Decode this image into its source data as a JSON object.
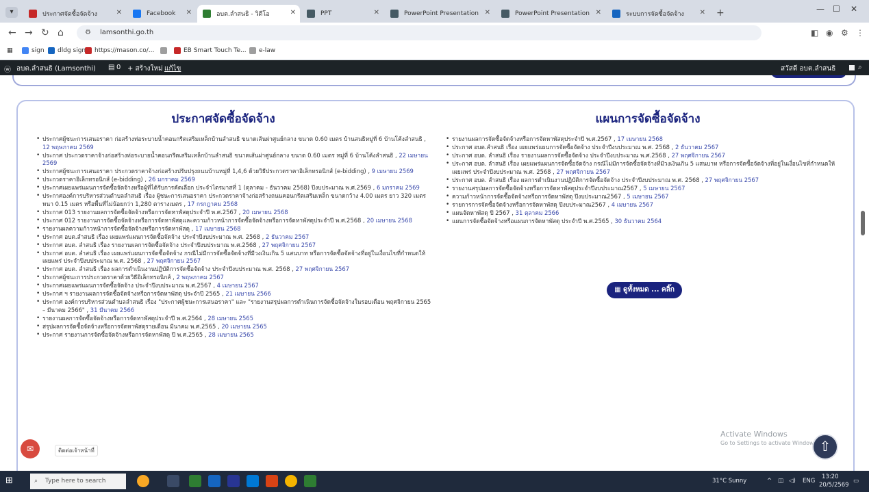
{
  "browser": {
    "tabs": [
      {
        "label": "ประกาศจัดซื้อจัดจ้าง",
        "color": "#c62828",
        "active": false
      },
      {
        "label": "Facebook",
        "color": "#1877f2",
        "active": false
      },
      {
        "label": "อบต.ลำสนธิ - วิดีโอ",
        "color": "#2e7d32",
        "active": true
      },
      {
        "label": "PPT",
        "color": "#455a64",
        "active": false
      },
      {
        "label": "PowerPoint Presentation",
        "color": "#455a64",
        "active": false
      },
      {
        "label": "PowerPoint Presentation",
        "color": "#455a64",
        "active": false
      },
      {
        "label": "ระบบการจัดซื้อจัดจ้าง",
        "color": "#1565c0",
        "active": false
      }
    ],
    "url": "lamsonthi.go.th",
    "bookmarks": [
      {
        "label": "sign",
        "color": "#4285f4"
      },
      {
        "label": "dldg sign",
        "color": "#1565c0"
      },
      {
        "label": "https://mason.co/...",
        "color": "#c62828"
      },
      {
        "label": "",
        "color": "#9e9e9e"
      },
      {
        "label": "EB Smart Touch Te...",
        "color": "#c62828"
      },
      {
        "label": "e-law",
        "color": "#9e9e9e"
      }
    ]
  },
  "adminbar": {
    "site_name": "อบต.ลำสนธิ (Lamsonthi)",
    "comments": "0",
    "new_label": "+ สร้างใหม่",
    "edit_label": "แก้ไข",
    "user_label": "สวัสดี อบต.ลำสนธิ"
  },
  "left": {
    "title": "ประกาศจัดซื้อจัดจ้าง",
    "items": [
      {
        "text": "ประกาศผู้ชนะการเสนอราคา ก่อสร้างท่อระบายน้ำคอนกรีตเสริมเหล็กบ้านลำสนธิ ขนาดเส้นผ่าศูนย์กลาง ขนาด 0.60 เมตร บ้านสนธิหมู่ที่ 6 บ้านโค้งลำสนธิ",
        "date": "12 พฤษภาคม 2569"
      },
      {
        "text": "ประกาศ ประกวดราคาจ้างก่อสร้างท่อระบายน้ำคอนกรีตเสริมเหล็กบ้านลำสนธิ ขนาดเส้นผ่าศูนย์กลาง ขนาด 0.60 เมตร หมู่ที่ 6 บ้านโค้งลำสนธิ",
        "date": "22 เมษายน 2569"
      },
      {
        "text": "ประกาศผู้ชนะการเสนอราคา ประกวดราคาจ้างก่อสร้างปรับปรุงถนนบ้านหมู่ที่ 1,4,6 ด้วยวิธีประกวดราคาอิเล็กทรอนิกส์ (e-bidding)",
        "date": "9 เมษายน 2569"
      },
      {
        "text": "ประกวดราคาอิเล็กทรอนิกส์ (e-bidding)",
        "date": "26 มกราคม 2569"
      },
      {
        "text": "ประกาศเผยแพร่แผนการจัดซื้อจัดจ้างหรือผู้ที่ได้รับการคัดเลือก ประจำไตรมาสที่ 1 (ตุลาคม - ธันวาคม 2568) ปีงบประมาณ พ.ศ.2569",
        "date": "6 มกราคม 2569"
      },
      {
        "text": "ประกาศองค์การบริหารส่วนตำบลลำสนธิ เรื่อง ผู้ชนะการเสนอราคา ประกวดราคาจ้างก่อสร้างถนนคอนกรีตเสริมเหล็ก ขนาดกว้าง 4.00 เมตร ยาว 320 เมตร หนา 0.15 เมตร หรือพื้นที่ไม่น้อยกว่า 1,280 ตารางเมตร",
        "date": "17 กรกฎาคม 2568"
      },
      {
        "text": "ประกาศ 013 รายงานผลการจัดซื้อจัดจ้างหรือการจัดหาพัสดุประจำปี พ.ศ.2567",
        "date": "20 เมษายน 2568"
      },
      {
        "text": "ประกาศ 012 รายงานการจัดซื้อจัดจ้างหรือการจัดหาพัสดุและความก้าวหน้าการจัดซื้อจัดจ้างหรือการจัดหาพัสดุประจำปี พ.ศ.2568",
        "date": "20 เมษายน 2568"
      },
      {
        "text": "รายงานผลความก้าวหน้าการจัดซื้อจัดจ้างหรือการจัดหาพัสดุ",
        "date": "17 เมษายน 2568"
      },
      {
        "text": "ประกาศ อบต.ลำสนธิ เรื่อง เผยแพร่แผนการจัดซื้อจัดจ้าง ประจำปีงบประมาณ พ.ศ. 2568",
        "date": "2 ธันวาคม 2567"
      },
      {
        "text": "ประกาศ อบต. ลำสนธิ เรื่อง รายงานผลการจัดซื้อจัดจ้าง ประจำปีงบประมาณ พ.ศ.2568",
        "date": "27 พฤศจิกายน 2567"
      },
      {
        "text": "ประกาศ อบต. ลำสนธิ เรื่อง เผยแพร่แผนการจัดซื้อจัดจ้าง กรณีไม่มีการจัดซื้อจัดจ้างที่มีวงเงินเกิน 5 แสนบาท หรือการจัดซื้อจัดจ้างที่อยู่ในเงื่อนไขที่กำหนดให้เผยแพร่ ประจำปีงบประมาณ พ.ศ. 2568",
        "date": "27 พฤศจิกายน 2567"
      },
      {
        "text": "ประกาศ อบต. ลำสนธิ เรื่อง ผลการดำเนินงานปฏิบัติการจัดซื้อจัดจ้าง ประจำปีงบประมาณ พ.ศ. 2568",
        "date": "27 พฤศจิกายน 2567"
      },
      {
        "text": "ประกาศผู้ชนะการประกวดราคาด้วยวิธีอิเล็กทรอนิกส์",
        "date": "2 พฤษภาคม 2567"
      },
      {
        "text": "ประกาศเผยแพร่แผนการจัดซื้อจัดจ้าง ประจำปีงบประมาณ พ.ศ.2567",
        "date": "4 เมษายน 2567"
      },
      {
        "text": "ประกาศ ฯ รายงานผลการจัดซื้อจัดจ้างหรือการจัดหาพัสดุ ประจำปี 2565",
        "date": "21 เมษายน 2566"
      },
      {
        "text": "ประกาศ องค์การบริหารส่วนตำบลลำสนธิ เรื่อง \"ประกาศผู้ชนะการเสนอราคา\" และ \"รายงานสรุปผลการดำเนินการจัดซื้อจัดจ้างในรอบเดือน พฤศจิกายน 2565 – มีนาคม 2566\"",
        "date": "31 มีนาคม 2566"
      },
      {
        "text": "รายงานผลการจัดซื้อจัดจ้างหรือการจัดหาพัสดุประจำปี พ.ศ.2564",
        "date": "28 เมษายน 2565"
      },
      {
        "text": "สรุปผลการจัดซื้อจัดจ้างหรือการจัดหาพัสดุรายเดือน มีนาคม พ.ศ.2565",
        "date": "20 เมษายน 2565"
      },
      {
        "text": "ประกาศ รายงานการจัดซื้อจัดจ้างหรือการจัดหาพัสดุ ปี พ.ศ.2565",
        "date": "28 เมษายน 2565"
      }
    ]
  },
  "right": {
    "title": "แผนการจัดซื้อจัดจ้าง",
    "items": [
      {
        "text": "รายงานผลการจัดซื้อจัดจ้างหรือการจัดหาพัสดุประจำปี พ.ศ.2567",
        "date": "17 เมษายน 2568"
      },
      {
        "text": "ประกาศ อบต.ลำสนธิ เรื่อง เผยแพร่แผนการจัดซื้อจัดจ้าง ประจำปีงบประมาณ พ.ศ. 2568",
        "date": "2 ธันวาคม 2567"
      },
      {
        "text": "ประกาศ อบต. ลำสนธิ เรื่อง รายงานผลการจัดซื้อจัดจ้าง ประจำปีงบประมาณ พ.ศ.2568",
        "date": "27 พฤศจิกายน 2567"
      },
      {
        "text": "ประกาศ อบต. ลำสนธิ เรื่อง เผยแพร่แผนการจัดซื้อจัดจ้าง กรณีไม่มีการจัดซื้อจัดจ้างที่มีวงเงินเกิน 5 แสนบาท หรือการจัดซื้อจัดจ้างที่อยู่ในเงื่อนไขที่กำหนดให้เผยแพร่ ประจำปีงบประมาณ พ.ศ. 2568",
        "date": "27 พฤศจิกายน 2567"
      },
      {
        "text": "ประกาศ อบต. ลำสนธิ เรื่อง ผลการดำเนินงานปฏิบัติการจัดซื้อจัดจ้าง ประจำปีงบประมาณ พ.ศ. 2568",
        "date": "27 พฤศจิกายน 2567"
      },
      {
        "text": "รายงานสรุปผลการจัดซื้อจัดจ้างหรือการจัดหาพัสดุประจำปีงบประมาณ2567",
        "date": "5 เมษายน 2567"
      },
      {
        "text": "ความก้าวหน้าการจัดซื้อจัดจ้างหรือการจัดหาพัสดุ ปีงบประมาณ2567",
        "date": "5 เมษายน 2567"
      },
      {
        "text": "รายการการจัดซื้อจัดจ้างหรือการจัดหาพัสดุ ปีงบประมาณ2567",
        "date": "4 เมษายน 2567"
      },
      {
        "text": "แผนจัดหาพัสดุ ปี 2567",
        "date": "31 ตุลาคม 2566"
      },
      {
        "text": "แผนการจัดซื้อจัดจ้างหรือแผนการจัดหาพัสดุ ประจำปี พ.ศ.2565",
        "date": "30 ธันวาคม 2564"
      }
    ],
    "more_button": "▦ ดูทั้งหมด ... คลิ๊ก"
  },
  "overlay": {
    "watermark_title": "Activate Windows",
    "watermark_sub": "Go to Settings to activate Windows.",
    "chat_tooltip": "ติดต่อเจ้าหน้าที่"
  },
  "taskbar": {
    "search_placeholder": "Type here to search",
    "weather": "31°C Sunny",
    "language": "ENG",
    "time": "13:20",
    "date": "20/5/2569"
  }
}
